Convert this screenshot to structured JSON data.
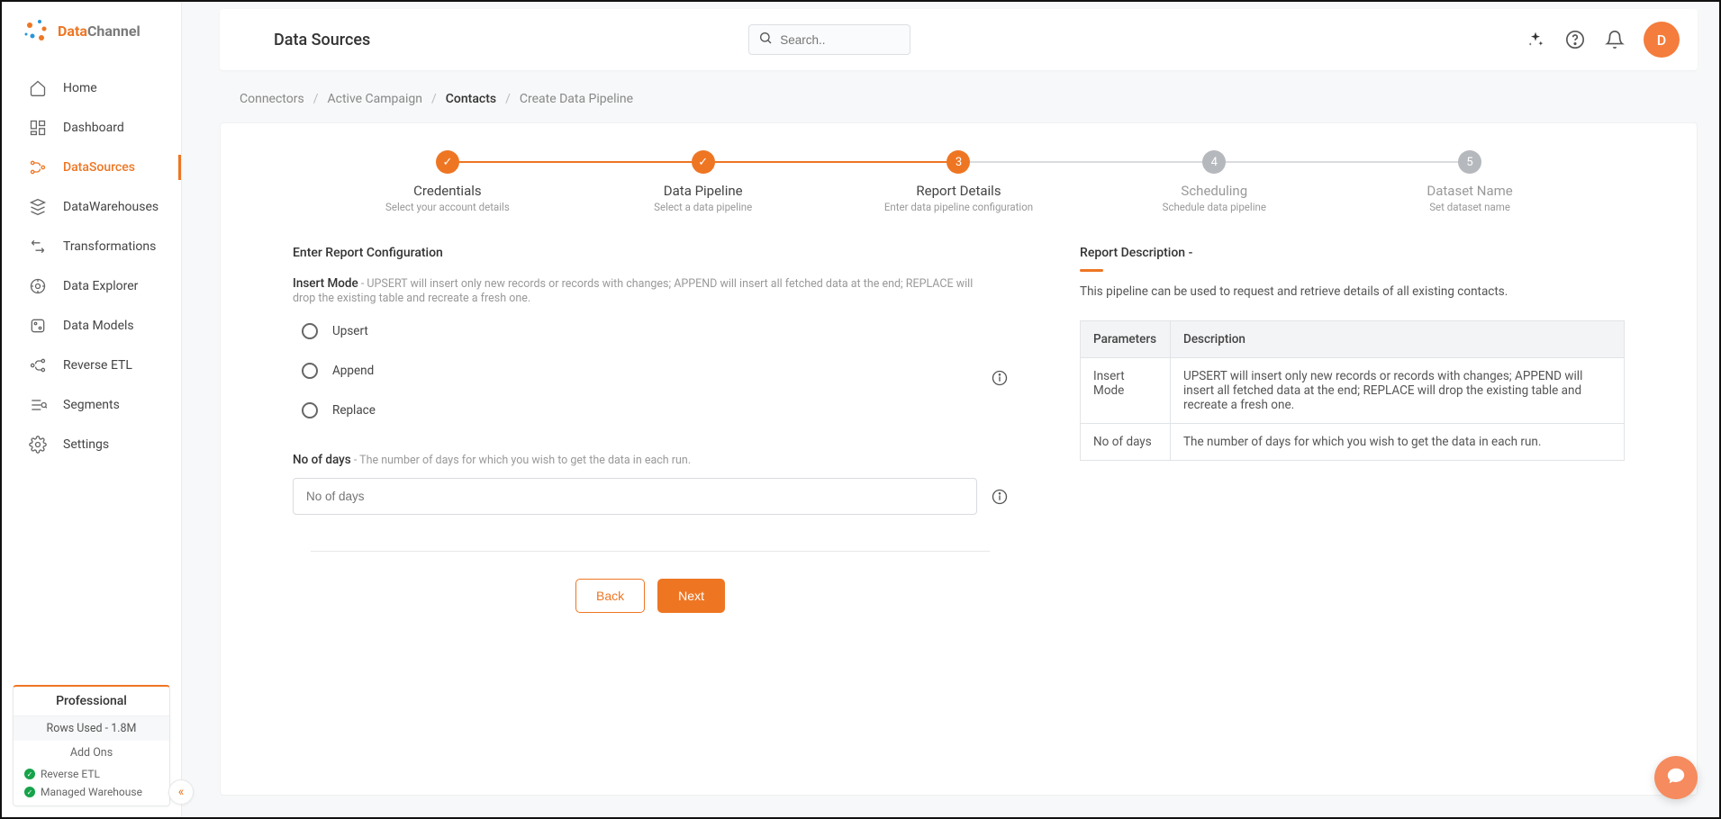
{
  "brand": {
    "name_part1": "Data",
    "name_part2": "Channel"
  },
  "sidebar": {
    "items": [
      {
        "label": "Home"
      },
      {
        "label": "Dashboard"
      },
      {
        "label": "DataSources"
      },
      {
        "label": "DataWarehouses"
      },
      {
        "label": "Transformations"
      },
      {
        "label": "Data Explorer"
      },
      {
        "label": "Data Models"
      },
      {
        "label": "Reverse ETL"
      },
      {
        "label": "Segments"
      },
      {
        "label": "Settings"
      }
    ]
  },
  "plan": {
    "title": "Professional",
    "rows_used": "Rows Used - 1.8M",
    "addons_title": "Add Ons",
    "addon1": "Reverse ETL",
    "addon2": "Managed Warehouse"
  },
  "topbar": {
    "title": "Data Sources",
    "search_placeholder": "Search..",
    "avatar_initial": "D"
  },
  "breadcrumb": {
    "a": "Connectors",
    "b": "Active Campaign",
    "c": "Contacts",
    "d": "Create Data Pipeline"
  },
  "stepper": [
    {
      "title": "Credentials",
      "sub": "Select your account details",
      "state": "done"
    },
    {
      "title": "Data Pipeline",
      "sub": "Select a data pipeline",
      "state": "done"
    },
    {
      "title": "Report Details",
      "sub": "Enter data pipeline configuration",
      "state": "current",
      "num": "3"
    },
    {
      "title": "Scheduling",
      "sub": "Schedule data pipeline",
      "state": "pending",
      "num": "4"
    },
    {
      "title": "Dataset Name",
      "sub": "Set dataset name",
      "state": "pending",
      "num": "5"
    }
  ],
  "form": {
    "section_title": "Enter Report Configuration",
    "insert_mode_label": "Insert Mode",
    "insert_mode_desc": " - UPSERT will insert only new records or records with changes; APPEND will insert all fetched data at the end; REPLACE will drop the existing table and recreate a fresh one.",
    "options": {
      "upsert": "Upsert",
      "append": "Append",
      "replace": "Replace"
    },
    "days_label": "No of days",
    "days_desc": " - The number of days for which you wish to get the data in each run.",
    "days_placeholder": "No of days",
    "back": "Back",
    "next": "Next"
  },
  "report": {
    "title": "Report Description -",
    "desc": "This pipeline can be used to request and retrieve details of all existing contacts.",
    "col1": "Parameters",
    "col2": "Description",
    "rows": [
      {
        "p": "Insert Mode",
        "d": "UPSERT will insert only new records or records with changes; APPEND will insert all fetched data at the end; REPLACE will drop the existing table and recreate a fresh one."
      },
      {
        "p": "No of days",
        "d": "The number of days for which you wish to get the data in each run."
      }
    ]
  }
}
